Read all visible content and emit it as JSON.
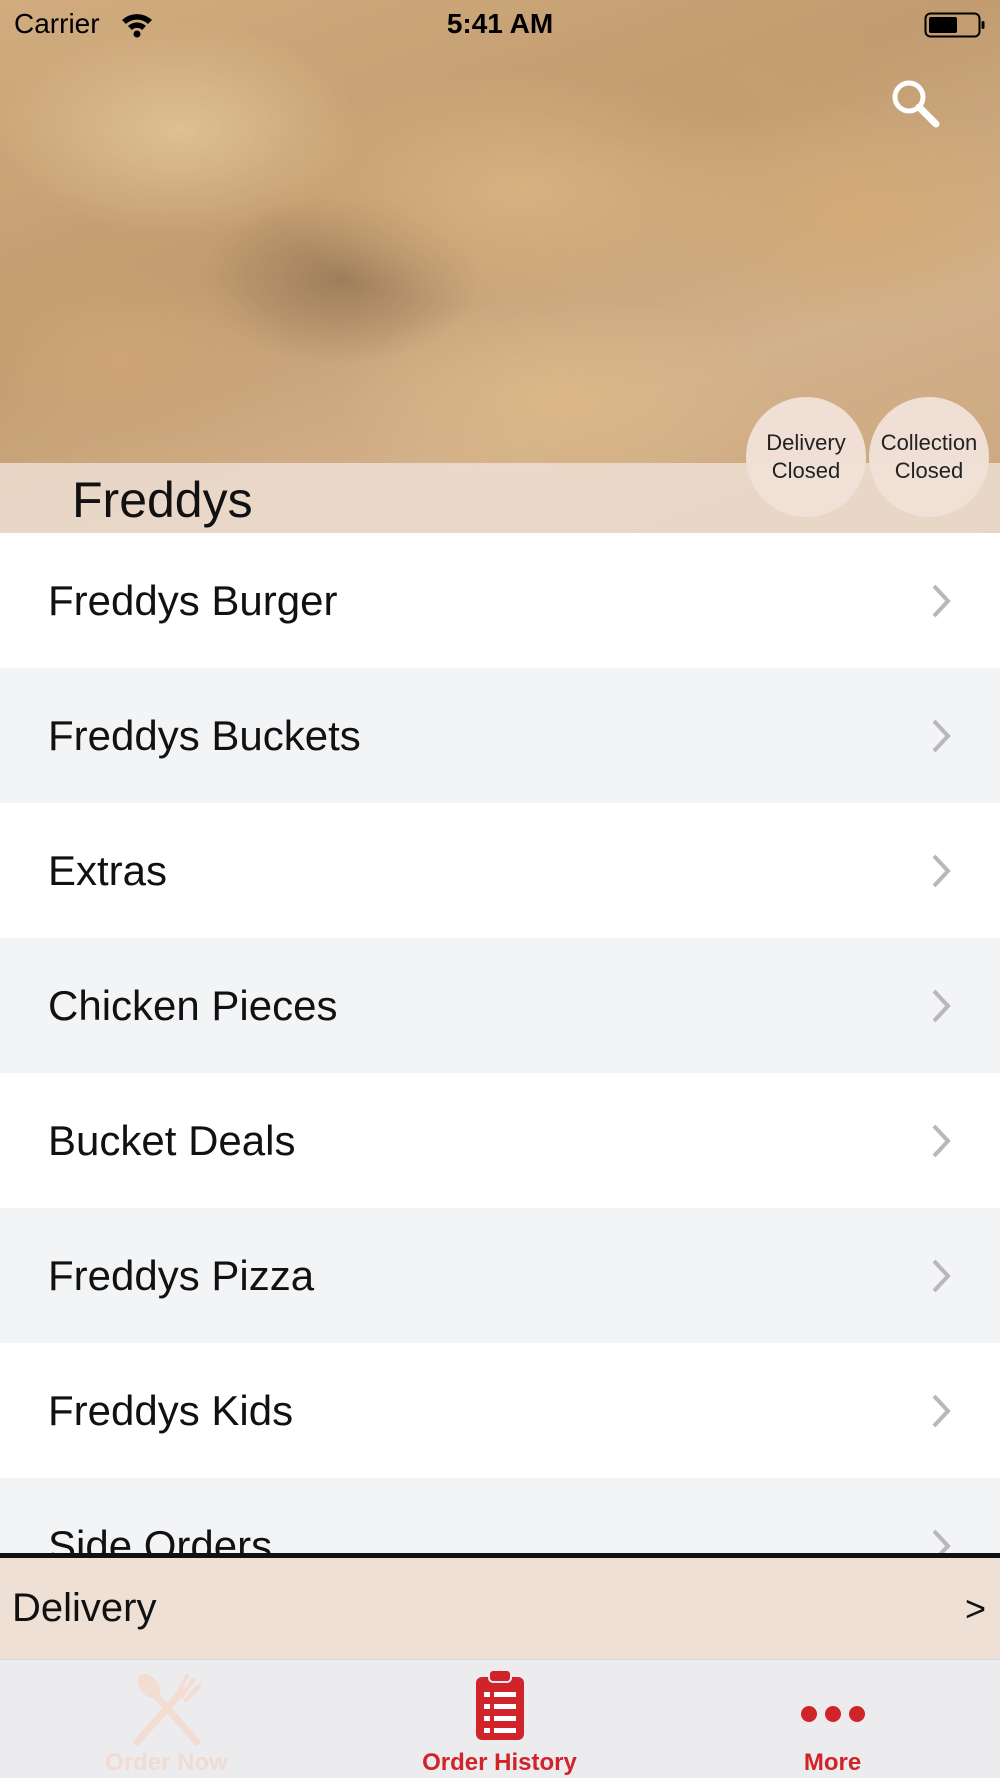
{
  "status_bar": {
    "carrier": "Carrier",
    "time": "5:41 AM",
    "icons": [
      "wifi-icon",
      "battery-icon"
    ]
  },
  "header": {
    "restaurant_name": "Freddys",
    "search_icon": "search-icon",
    "delivery_status": {
      "line1": "Delivery",
      "line2": "Closed"
    },
    "collection_status": {
      "line1": "Collection",
      "line2": "Closed"
    }
  },
  "menu": {
    "items": [
      {
        "label": "Freddys Burger"
      },
      {
        "label": "Freddys Buckets"
      },
      {
        "label": "Extras"
      },
      {
        "label": "Chicken Pieces"
      },
      {
        "label": "Bucket Deals"
      },
      {
        "label": "Freddys Pizza"
      },
      {
        "label": "Freddys Kids"
      },
      {
        "label": "Side Orders"
      }
    ],
    "row_icon": "chevron-right-icon"
  },
  "delivery_bar": {
    "label": "Delivery",
    "arrow": ">"
  },
  "tab_bar": {
    "tabs": [
      {
        "label": "Order Now",
        "icon": "fork-knife-icon"
      },
      {
        "label": "Order History",
        "icon": "clipboard-list-icon"
      },
      {
        "label": "More",
        "icon": "more-dots-icon"
      }
    ]
  },
  "colors": {
    "accent": "#d1232a",
    "delivery_bar_bg": "#efe0d6",
    "row_alt_bg": "#f3f4f6",
    "tab_inactive": "#f0dcd2"
  }
}
